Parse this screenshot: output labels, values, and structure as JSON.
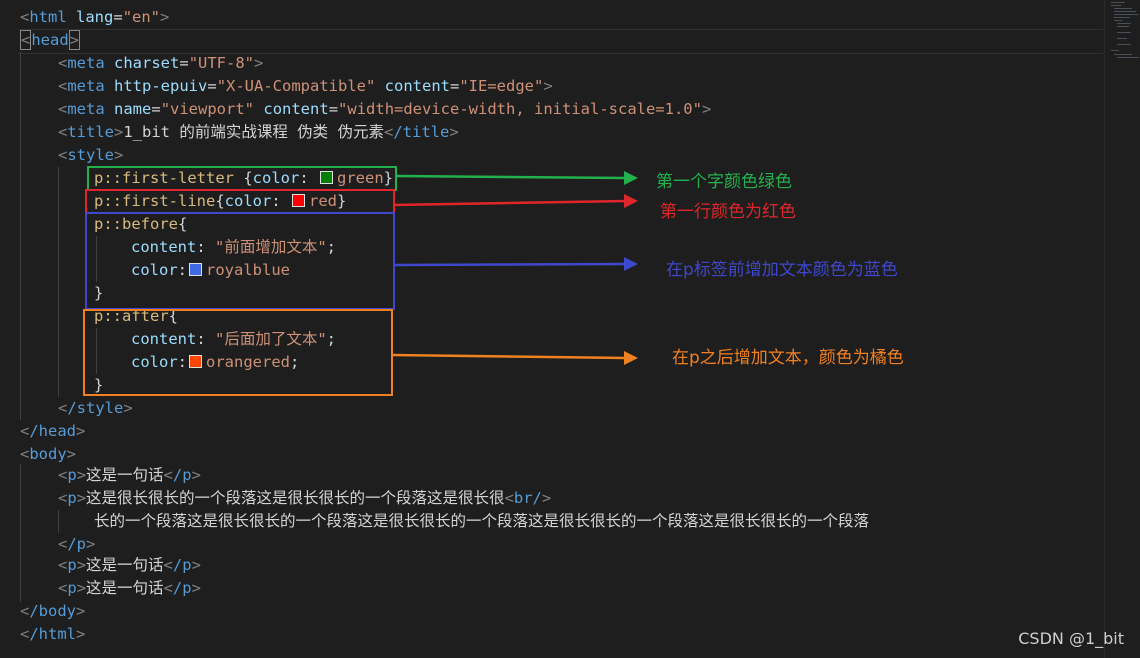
{
  "code": {
    "l1": {
      "open": "<",
      "tag": "html",
      "attr": "lang",
      "eq": "=",
      "val": "\"en\"",
      "close": ">"
    },
    "l2": {
      "open": "<",
      "tag": "head",
      "close": ">"
    },
    "l3": {
      "tag": "meta",
      "attr": "charset",
      "val": "\"UTF-8\""
    },
    "l4": {
      "tag": "meta",
      "attr1": "http-epuiv",
      "val1": "\"X-UA-Compatible\"",
      "attr2": "content",
      "val2": "\"IE=edge\""
    },
    "l5": {
      "tag": "meta",
      "attr1": "name",
      "val1": "\"viewport\"",
      "attr2": "content",
      "val2": "\"width=device-width, initial-scale=1.0\""
    },
    "l6": {
      "tag": "title",
      "text": "1_bit 的前端实战课程 伪类 伪元素",
      "endtag": "/title"
    },
    "l7": {
      "tag": "style"
    },
    "l8": {
      "sel": "p::first-letter",
      "brace": " {",
      "prop": "color",
      "colon": ": ",
      "val": "green",
      "end": "}",
      "swatch": "#008000"
    },
    "l9": {
      "sel": "p::first-line",
      "brace": "{",
      "prop": "color",
      "colon": ": ",
      "val": "red",
      "end": "}",
      "swatch": "#ff0000"
    },
    "l10": {
      "sel": "p::before",
      "brace": "{"
    },
    "l11": {
      "prop": "content",
      "colon": ": ",
      "val": "\"前面增加文本\"",
      "end": ";"
    },
    "l12": {
      "prop": "color",
      "colon": ":",
      "val": "royalblue",
      "swatch": "#4169e1"
    },
    "l13": {
      "text": "}"
    },
    "l14": {
      "sel": "p::after",
      "brace": "{"
    },
    "l15": {
      "prop": "content",
      "colon": ": ",
      "val": "\"后面加了文本\"",
      "end": ";"
    },
    "l16": {
      "prop": "color",
      "colon": ":",
      "val": "orangered",
      "end": ";",
      "swatch": "#ff4500"
    },
    "l17": {
      "text": "}"
    },
    "l18": {
      "tag": "/style"
    },
    "l19": {
      "tag": "/head"
    },
    "l20": {
      "tag": "body"
    },
    "l21": {
      "text": "这是一句话"
    },
    "l22": {
      "text": "这是很长很长的一个段落这是很长很长的一个段落这是很长很",
      "br": "br/"
    },
    "l23": {
      "text": "长的一个段落这是很长很长的一个段落这是很长很长的一个段落这是很长很长的一个段落这是很长很长的一个段落"
    },
    "l24": {
      "tag": "/p"
    },
    "l25": {
      "text": "这是一句话"
    },
    "l26": {
      "text": "这是一句话"
    },
    "l27": {
      "tag": "/body"
    },
    "l28": {
      "tag": "/html"
    },
    "ptag": "p",
    "ptag_close": "/p",
    "lt": "<",
    "gt": ">",
    "eq": "=",
    "sp": " "
  },
  "annotations": [
    {
      "text": "第一个字颜色绿色",
      "color": "#22b14c"
    },
    {
      "text": "第一行颜色为红色",
      "color": "#e0262a"
    },
    {
      "text": "在p标签前增加文本颜色为蓝色",
      "color": "#3f48cc"
    },
    {
      "text": "在p之后增加文本，颜色为橘色",
      "color": "#f08020"
    }
  ],
  "watermark": "CSDN @1_bit"
}
